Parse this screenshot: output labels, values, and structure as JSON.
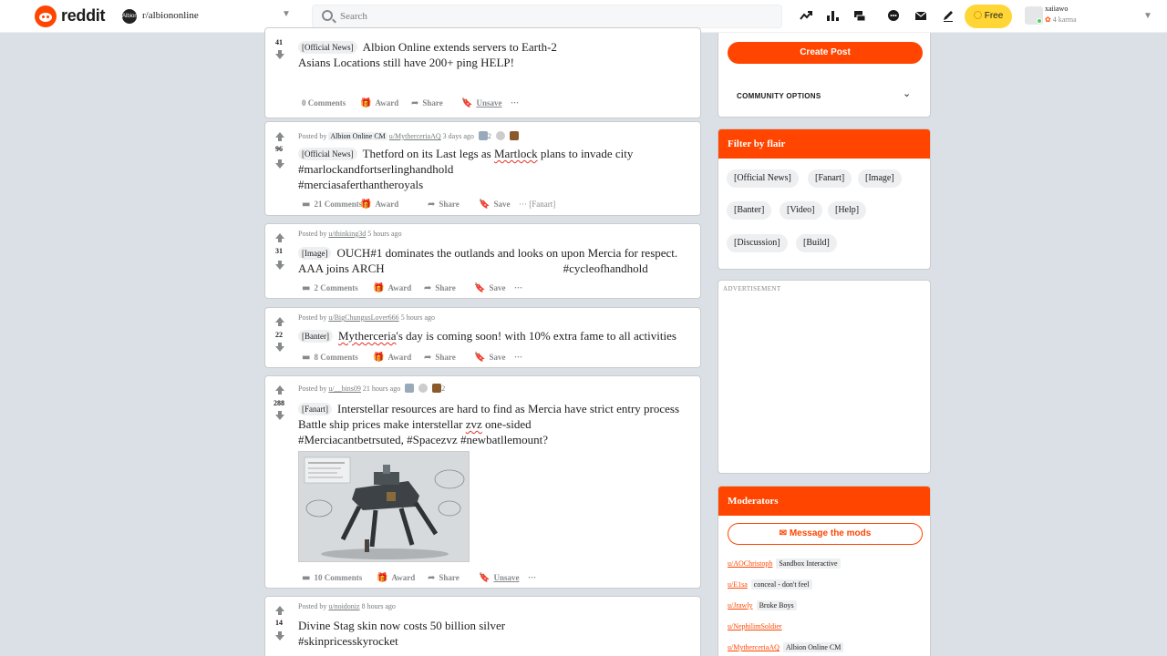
{
  "header": {
    "brand": "reddit",
    "community": {
      "icon_text": "Albion",
      "name": "r/albiononline"
    },
    "search": {
      "placeholder": "Search"
    },
    "free_label": "Free",
    "user": {
      "name": "xaiiawo",
      "karma": "4 karma"
    },
    "icons": [
      "trending-icon",
      "stats-icon",
      "chat-icon",
      "message-icon",
      "mail-icon",
      "pencil-icon"
    ]
  },
  "posts": [
    {
      "votes": "41",
      "flair": "[Official News]",
      "title_lines": [
        "Albion Online extends servers to Earth-2",
        "Asians Locations still have 200+ ping HELP!"
      ],
      "actions": {
        "comments": "0 Comments",
        "award": "Award",
        "share": "Share",
        "save": "Unsave",
        "more": "···"
      }
    },
    {
      "votes": "96",
      "meta": {
        "posted_by": "Posted by",
        "user_flair": "Albion Online CM",
        "user": "u/MytherceriaAQ",
        "time": "3 days ago",
        "award_count": "2"
      },
      "flair": "[Official News]",
      "title_lines": [
        "Thetford on its Last legs as Martlock plans to invade city",
        "#marlockandfortserlinghandhold",
        "#merciasaferthantheroyals"
      ],
      "spell_word": "Martlock",
      "actions": {
        "comments": "21 Comments",
        "award": "Award",
        "share": "Share",
        "save": "Save",
        "more": "···",
        "tag": "[Fanart]"
      }
    },
    {
      "votes": "31",
      "meta": {
        "posted_by": "Posted by",
        "user": "u/thinking3d",
        "time": "5 hours ago"
      },
      "flair": "[Image]",
      "title_lines": [
        "OUCH#1 dominates the outlands and looks on upon Mercia for respect.",
        "AAA joins ARCH",
        "#cycleofhandhold"
      ],
      "actions": {
        "comments": "2 Comments",
        "award": "Award",
        "share": "Share",
        "save": "Save",
        "more": "···"
      }
    },
    {
      "votes": "22",
      "meta": {
        "posted_by": "Posted by",
        "user": "u/BigChungusLover666",
        "time": "5 hours ago"
      },
      "flair": "[Banter]",
      "title_lines": [
        "Mytherceria's day is coming soon! with 10% extra fame to all activities"
      ],
      "actions": {
        "comments": "8 Comments",
        "award": "Award",
        "share": "Share",
        "save": "Save",
        "more": "···"
      }
    },
    {
      "votes": "288",
      "meta": {
        "posted_by": "Posted by",
        "user": "u/__bins09",
        "time": "21 hours ago",
        "award_count": "2"
      },
      "flair": "[Fanart]",
      "title_lines": [
        "Interstellar resources are hard to find as Mercia have strict entry process",
        "Battle ship prices make interstellar zvz one-sided",
        "#Merciacantbetrsuted, #Spacezvz #newbatllemount?"
      ],
      "actions": {
        "comments": "10 Comments",
        "award": "Award",
        "share": "Share",
        "save": "Unsave",
        "more": "···"
      }
    },
    {
      "votes": "14",
      "meta": {
        "posted_by": "Posted by",
        "user": "u/noidoniz",
        "time": "8 hours ago"
      },
      "title_lines": [
        "Divine Stag skin now costs 50 billion silver",
        "#skinpricesskyrocket"
      ]
    }
  ],
  "sidebar": {
    "create_post": "Create Post",
    "community_options": "COMMUNITY OPTIONS",
    "filter_title": "Filter by flair",
    "flairs": [
      "[Official News]",
      "[Fanart]",
      "[Image]",
      "[Banter]",
      "[Video]",
      "[Help]",
      "[Discussion]",
      "[Build]"
    ],
    "advertisement": "ADVERTISEMENT",
    "moderators_title": "Moderators",
    "message_mods": "Message the mods",
    "mods": [
      {
        "name": "u/AOChristoph",
        "flair": "Sandbox Interactive"
      },
      {
        "name": "u/E1sa",
        "flair": "conceal - don't feel"
      },
      {
        "name": "u/Jrawly",
        "flair": "Broke Boys"
      },
      {
        "name": "u/NephilimSoldier",
        "flair": ""
      },
      {
        "name": "u/MytherceriaAQ",
        "flair": "Albion Online CM"
      }
    ]
  },
  "colors": {
    "accent": "#ff4500",
    "background": "#dae0e6",
    "free_button": "#ffd635"
  }
}
